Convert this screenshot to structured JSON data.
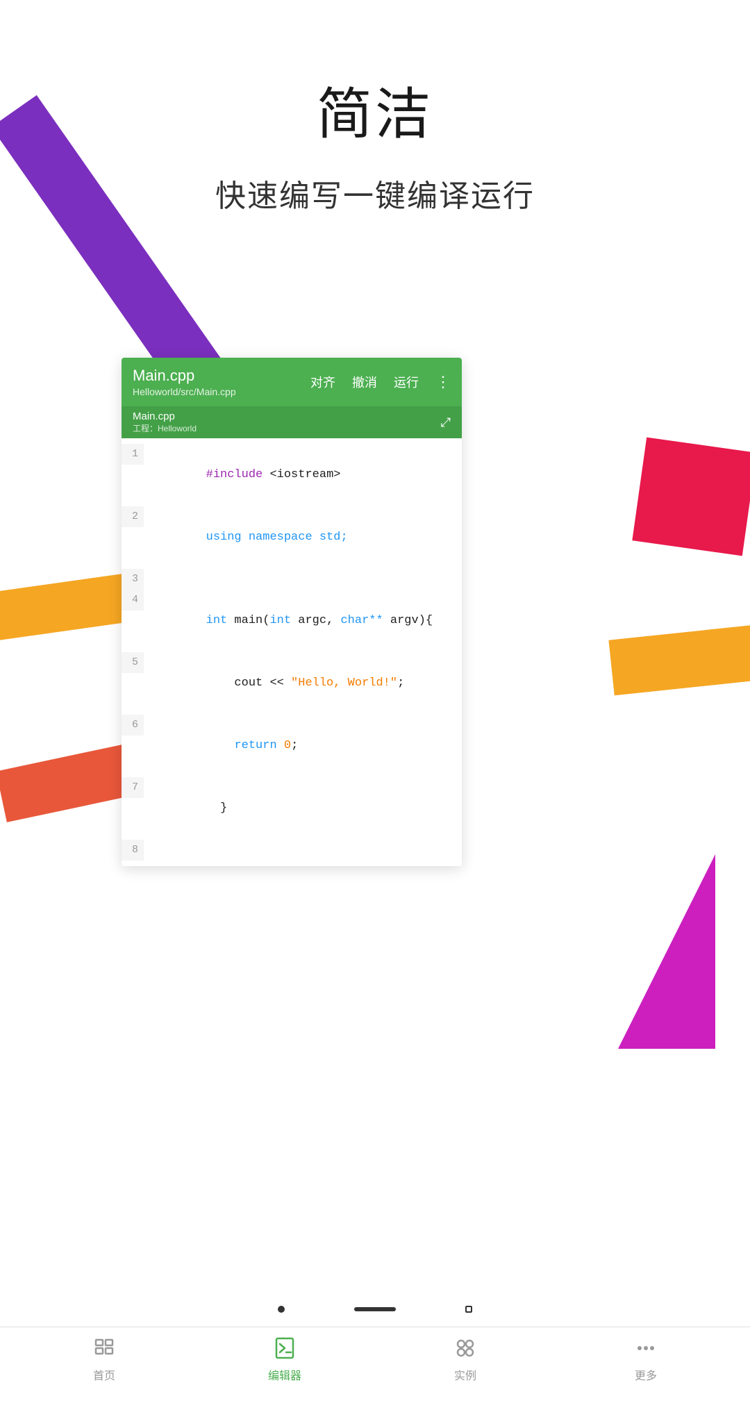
{
  "page": {
    "title": "简洁",
    "subtitle": "快速编写一键编译运行"
  },
  "editor": {
    "filename": "Main.cpp",
    "filepath": "Helloworld/src/Main.cpp",
    "tab_name": "Main.cpp",
    "tab_project": "工程：Helloworld",
    "action_align": "对齐",
    "action_undo": "撤消",
    "action_run": "运行"
  },
  "code": {
    "lines": [
      {
        "num": "1",
        "content": "#include <iostream>"
      },
      {
        "num": "2",
        "content": "using namespace std;"
      },
      {
        "num": "3",
        "content": ""
      },
      {
        "num": "4",
        "content": "int main(int argc, char** argv){"
      },
      {
        "num": "5",
        "content": "    cout << \"Hello, World!\";"
      },
      {
        "num": "6",
        "content": "    return 0;"
      },
      {
        "num": "7",
        "content": "  }"
      },
      {
        "num": "8",
        "content": ""
      }
    ]
  },
  "nav": {
    "items": [
      {
        "label": "首页",
        "active": false
      },
      {
        "label": "编辑器",
        "active": true
      },
      {
        "label": "实例",
        "active": false
      },
      {
        "label": "更多",
        "active": false
      }
    ]
  }
}
